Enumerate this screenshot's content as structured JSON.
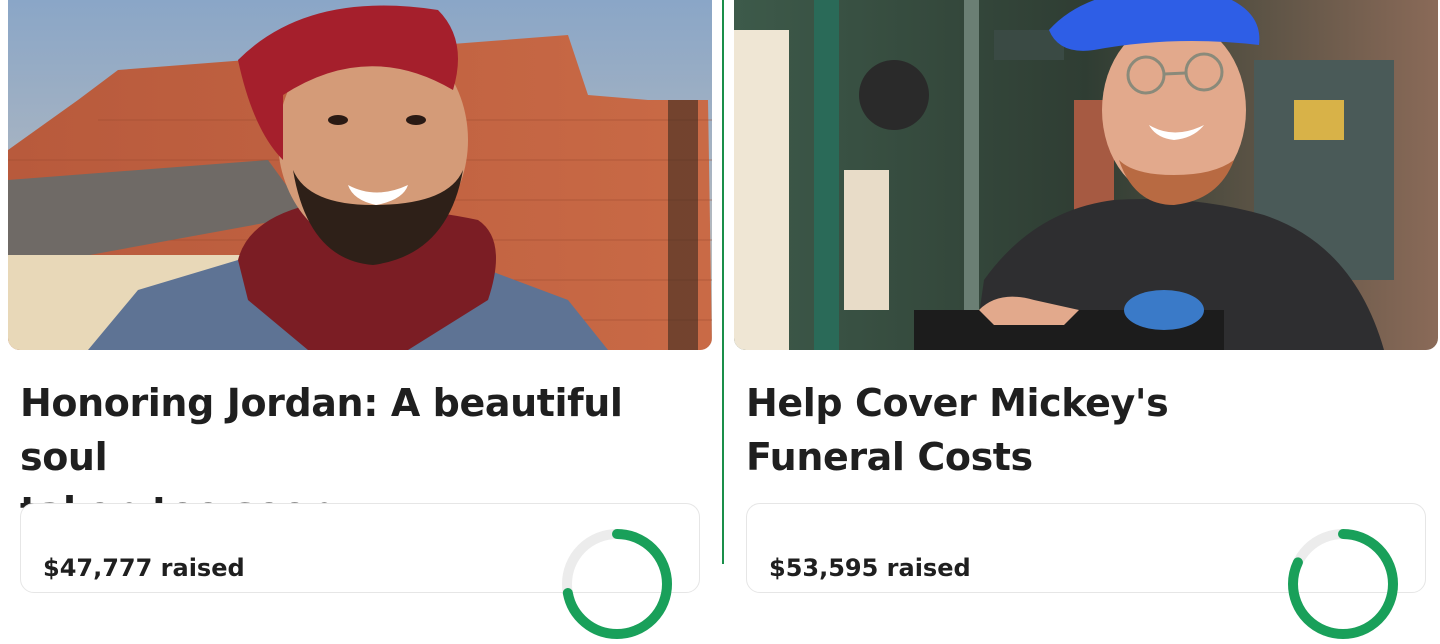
{
  "divider_color": "#1a8f4a",
  "progress_color": "#19a05a",
  "cards": [
    {
      "title_line1": "Honoring Jordan: A beautiful soul",
      "title_line2": "taken too soon.",
      "raised_text": "$47,777 raised",
      "progress_fraction": 0.72,
      "photo_description": "man-with-red-beanie"
    },
    {
      "title_line1": "Help Cover Mickey's",
      "title_line2": "Funeral Costs",
      "raised_text": "$53,595 raised",
      "progress_fraction": 0.82,
      "photo_description": "man-with-blue-cap"
    }
  ]
}
